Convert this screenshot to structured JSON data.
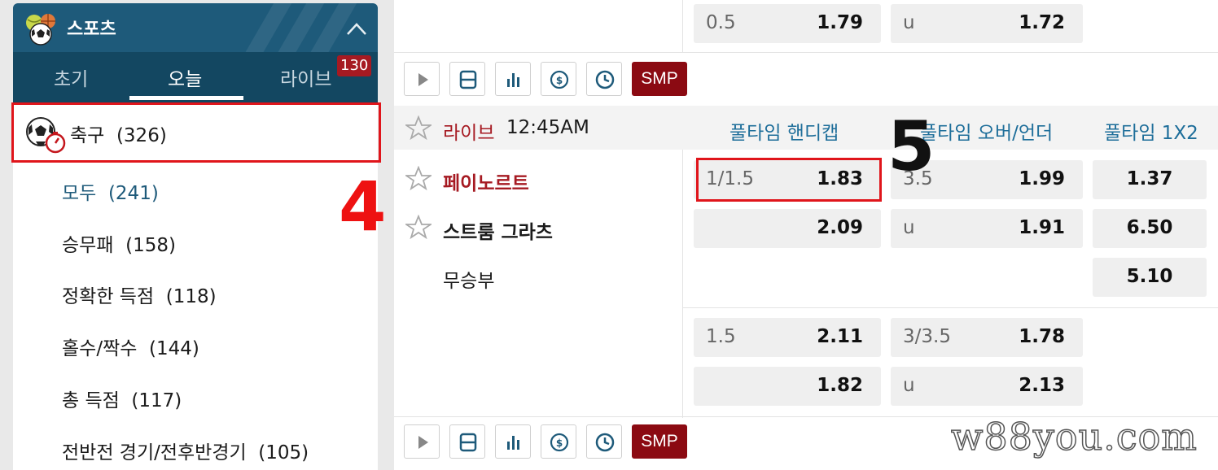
{
  "sidebar": {
    "title": "스포츠",
    "tabs": [
      {
        "label": "초기"
      },
      {
        "label": "오늘"
      },
      {
        "label": "라이브"
      }
    ],
    "live_badge": "130",
    "sport": {
      "label": "축구",
      "count": "(326)"
    },
    "items": [
      {
        "label": "모두",
        "count": "(241)"
      },
      {
        "label": "승무패",
        "count": "(158)"
      },
      {
        "label": "정확한 득점",
        "count": "(118)"
      },
      {
        "label": "홀수/짝수",
        "count": "(144)"
      },
      {
        "label": "총 득점",
        "count": "(117)"
      },
      {
        "label": "전반전 경기/전후반경기",
        "count": "(105)"
      }
    ]
  },
  "top_row": {
    "a": {
      "label": "0.5",
      "value": "1.79"
    },
    "b": {
      "label": "u",
      "value": "1.72"
    }
  },
  "toolbar": {
    "smp_label": "SMP"
  },
  "match": {
    "live_label": "라이브",
    "time": "12:45AM",
    "col_handicap": "풀타임 핸디캡",
    "col_overunder": "풀타임 오버/언더",
    "col_1x2": "풀타임 1X2",
    "home": "페이노르트",
    "away": "스트룸 그라츠",
    "draw": "무승부",
    "odds": {
      "hcp_home": {
        "label": "1/1.5",
        "value": "1.83"
      },
      "hcp_away": {
        "label": "",
        "value": "2.09"
      },
      "ou_over": {
        "label": "3.5",
        "value": "1.99"
      },
      "ou_under": {
        "label": "u",
        "value": "1.91"
      },
      "x12_home": "1.37",
      "x12_away": "6.50",
      "x12_draw": "5.10",
      "hcp2_home": {
        "label": "1.5",
        "value": "2.11"
      },
      "hcp2_away": {
        "label": "",
        "value": "1.82"
      },
      "ou2_over": {
        "label": "3/3.5",
        "value": "1.78"
      },
      "ou2_under": {
        "label": "u",
        "value": "2.13"
      }
    }
  },
  "annotations": {
    "step4": "4",
    "step5": "5"
  },
  "watermark": "w88you.com",
  "colors": {
    "header_blue": "#1e5a7a",
    "tabs_blue": "#134761",
    "live_red": "#a61a22",
    "smp_red": "#8b0a12",
    "highlight_red": "#e0151b",
    "link_blue": "#1e6e9a"
  }
}
